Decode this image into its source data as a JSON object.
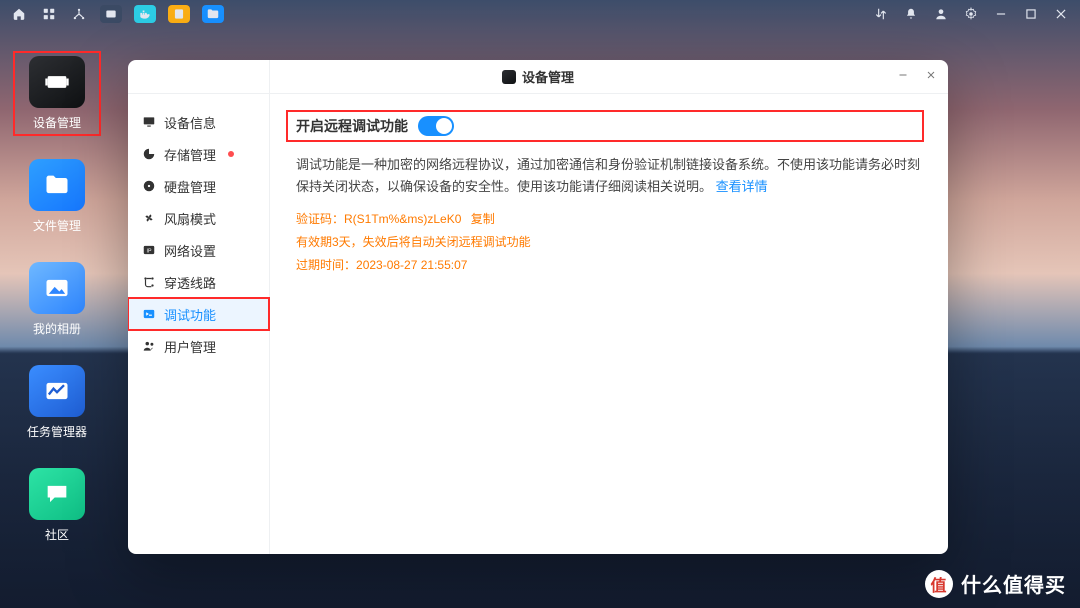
{
  "window": {
    "title": "设备管理",
    "controls": {
      "minimize_aria": "minimize",
      "close_aria": "close"
    }
  },
  "sidebar": {
    "items": [
      {
        "label": "设备信息"
      },
      {
        "label": "存储管理",
        "dot": true
      },
      {
        "label": "硬盘管理"
      },
      {
        "label": "风扇模式"
      },
      {
        "label": "网络设置"
      },
      {
        "label": "穿透线路"
      },
      {
        "label": "调试功能",
        "active": true
      },
      {
        "label": "用户管理"
      }
    ]
  },
  "content": {
    "switch_label": "开启远程调试功能",
    "switch_on": true,
    "desc_part1": "调试功能是一种加密的网络远程协议，通过加密通信和身份验证机制链接设备系统。不使用该功能请务必时刻保持关闭状态，以确保设备的安全性。使用该功能请仔细阅读相关说明。",
    "desc_link": "查看详情",
    "code_label": "验证码：",
    "code_value": "R(S1Tm%&ms)zLeK0",
    "copy_label": "复制",
    "validity_text": "有效期3天，失效后将自动关闭远程调试功能",
    "expire_label": "过期时间：",
    "expire_value": "2023-08-27 21:55:07"
  },
  "desktop_apps": [
    {
      "label": "设备管理",
      "icon": "device",
      "highlight": true
    },
    {
      "label": "文件管理",
      "icon": "folder"
    },
    {
      "label": "我的相册",
      "icon": "photo"
    },
    {
      "label": "任务管理器",
      "icon": "task"
    },
    {
      "label": "社区",
      "icon": "community"
    }
  ],
  "watermark": {
    "text": "什么值得买",
    "badge": "值"
  }
}
